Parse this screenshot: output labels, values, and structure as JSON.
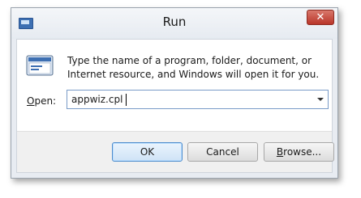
{
  "window": {
    "title": "Run",
    "close_label": "✕"
  },
  "dialog": {
    "description": "Type the name of a program, folder, document, or Internet resource, and Windows will open it for you.",
    "open_label_underlined": "O",
    "open_label_rest": "pen:",
    "open_value": "appwiz.cpl"
  },
  "buttons": {
    "ok": "OK",
    "cancel": "Cancel",
    "browse_underlined": "B",
    "browse_rest": "rowse..."
  },
  "icons": {
    "title": "run-app-icon",
    "dialog": "run-icon",
    "dropdown": "chevron-down-icon"
  }
}
